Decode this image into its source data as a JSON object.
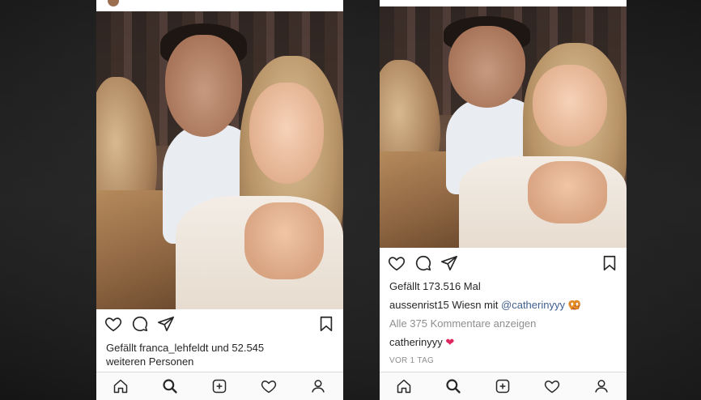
{
  "left_post": {
    "likes_text": "Gefällt franca_lehfeldt und 52.545",
    "likes_text_2": "weiteren Personen"
  },
  "right_post": {
    "likes_text": "Gefällt 173.516 Mal",
    "caption_user": "aussenrist15",
    "caption_text": " Wiesn mit ",
    "caption_mention": "@catherinyyy",
    "caption_emoji": " 🥨",
    "comments_link": "Alle 375 Kommentare anzeigen",
    "comment_user": "catherinyyy",
    "comment_emoji": " ❤",
    "time": "VOR 1 TAG"
  },
  "icons": {
    "like": "heart-outline-icon",
    "comment": "comment-bubble-icon",
    "share": "paper-plane-icon",
    "save": "bookmark-icon",
    "nav": [
      "home-icon",
      "search-icon",
      "add-post-icon",
      "activity-heart-icon",
      "profile-icon"
    ]
  },
  "colors": {
    "text": "#262626",
    "muted": "#8e8e8e",
    "mention": "#3f5f8f",
    "heart": "#e0245e"
  }
}
